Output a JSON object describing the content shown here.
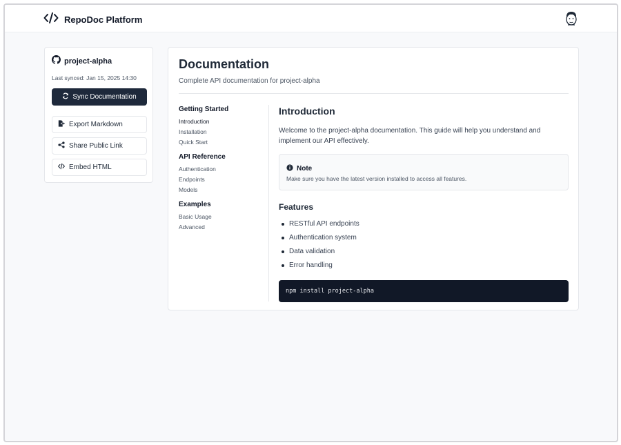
{
  "header": {
    "brand_icon": "code-icon",
    "title": "RepoDoc Platform",
    "avatar_icon": "user-avatar"
  },
  "sidebar": {
    "repo_icon": "github-icon",
    "repo_name": "project-alpha",
    "last_synced": "Last synced: Jan 15, 2025 14:30",
    "sync_button": {
      "label": "Sync Documentation",
      "icon": "sync-icon"
    },
    "actions": [
      {
        "label": "Export Markdown",
        "icon": "file-export-icon"
      },
      {
        "label": "Share Public Link",
        "icon": "share-icon"
      },
      {
        "label": "Embed HTML",
        "icon": "code-icon"
      }
    ]
  },
  "main": {
    "title": "Documentation",
    "subtitle": "Complete API documentation for project-alpha",
    "toc": [
      {
        "section": "Getting Started",
        "items": [
          "Introduction",
          "Installation",
          "Quick Start"
        ]
      },
      {
        "section": "API Reference",
        "items": [
          "Authentication",
          "Endpoints",
          "Models"
        ]
      },
      {
        "section": "Examples",
        "items": [
          "Basic Usage",
          "Advanced"
        ]
      }
    ],
    "content": {
      "heading": "Introduction",
      "intro": "Welcome to the project-alpha documentation. This guide will help you understand and implement our API effectively.",
      "note": {
        "icon": "info-icon",
        "title": "Note",
        "body": "Make sure you have the latest version installed to access all features."
      },
      "features_heading": "Features",
      "features": [
        "RESTful API endpoints",
        "Authentication system",
        "Data validation",
        "Error handling"
      ],
      "code": "npm install project-alpha"
    }
  },
  "colors": {
    "primary_button": "#1e293b",
    "code_background": "#111827",
    "page_background": "#f8f9fb"
  }
}
